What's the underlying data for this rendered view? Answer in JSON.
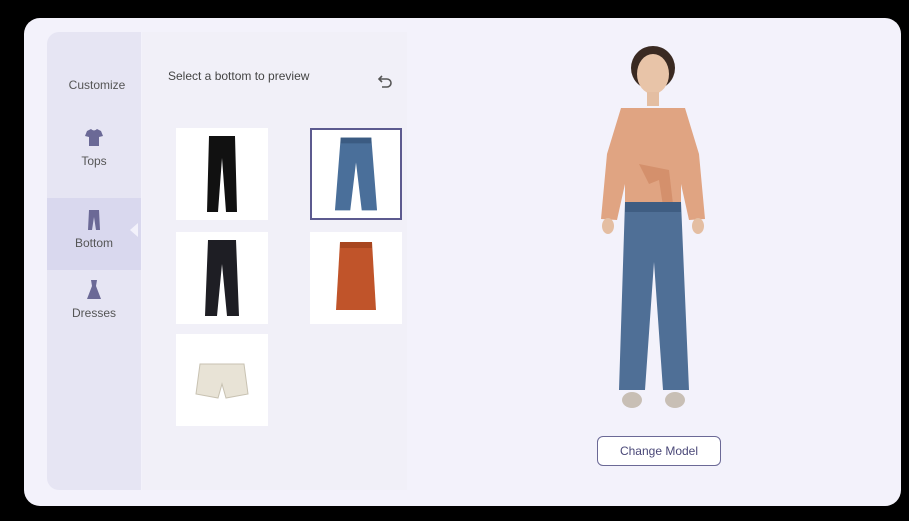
{
  "sidebar": {
    "title": "Customize",
    "items": [
      {
        "label": "Tops",
        "icon": "shirt-icon",
        "active": false
      },
      {
        "label": "Bottom",
        "icon": "pants-icon",
        "active": true
      },
      {
        "label": "Dresses",
        "icon": "dress-icon",
        "active": false
      }
    ]
  },
  "panel": {
    "title": "Select a bottom to preview",
    "undo_icon": "undo-icon",
    "items": [
      {
        "name": "black slim pants",
        "selected": false
      },
      {
        "name": "blue flared jeans",
        "selected": true
      },
      {
        "name": "black trousers",
        "selected": false
      },
      {
        "name": "rust pencil skirt",
        "selected": false
      },
      {
        "name": "white shorts",
        "selected": false
      }
    ]
  },
  "preview": {
    "change_model_label": "Change Model"
  },
  "colors": {
    "accent": "#5c5a8f",
    "sidebar_bg": "#e6e5f3",
    "active_bg": "#d9d8ee",
    "card_bg": "#f3f2fb"
  }
}
